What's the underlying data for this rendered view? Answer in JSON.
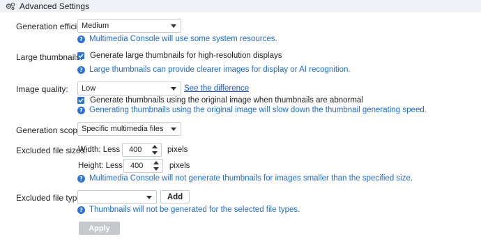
{
  "header": {
    "title": "Advanced Settings",
    "icon": "gear-settings-icon"
  },
  "efficiency": {
    "label": "Generation efficiency:",
    "value": "Medium",
    "info": "Multimedia Console will use some system resources."
  },
  "thumbnails": {
    "label": "Large thumbnails:",
    "checkbox_label": "Generate large thumbnails for high-resolution displays",
    "checked": true,
    "info": "Large thumbnails can provide clearer images for display or AI recognition."
  },
  "quality": {
    "label": "Image quality:",
    "value": "Low",
    "link": "See the difference",
    "checkbox_label": "Generate thumbnails using the original image when thumbnails are abnormal",
    "checked": true,
    "info": "Generating thumbnails using the original image will slow down the thumbnail generating speed."
  },
  "scope": {
    "label": "Generation scope:",
    "value": "Specific multimedia files"
  },
  "sizes": {
    "label": "Excluded file sizes:",
    "width_label": "Width: Less than",
    "width_value": "400",
    "height_label": "Height: Less than",
    "height_value": "400",
    "unit": "pixels",
    "info": "Multimedia Console will not generate thumbnails for images smaller than the specified size."
  },
  "types": {
    "label": "Excluded file types:",
    "value": "",
    "add_label": "Add",
    "info": "Thumbnails will not be generated for the selected file types."
  },
  "apply_label": "Apply",
  "colors": {
    "accent": "#2b73d8",
    "link": "#1a55c9",
    "header_bg": "#eef1f5",
    "apply_disabled": "#c5c9ce"
  }
}
